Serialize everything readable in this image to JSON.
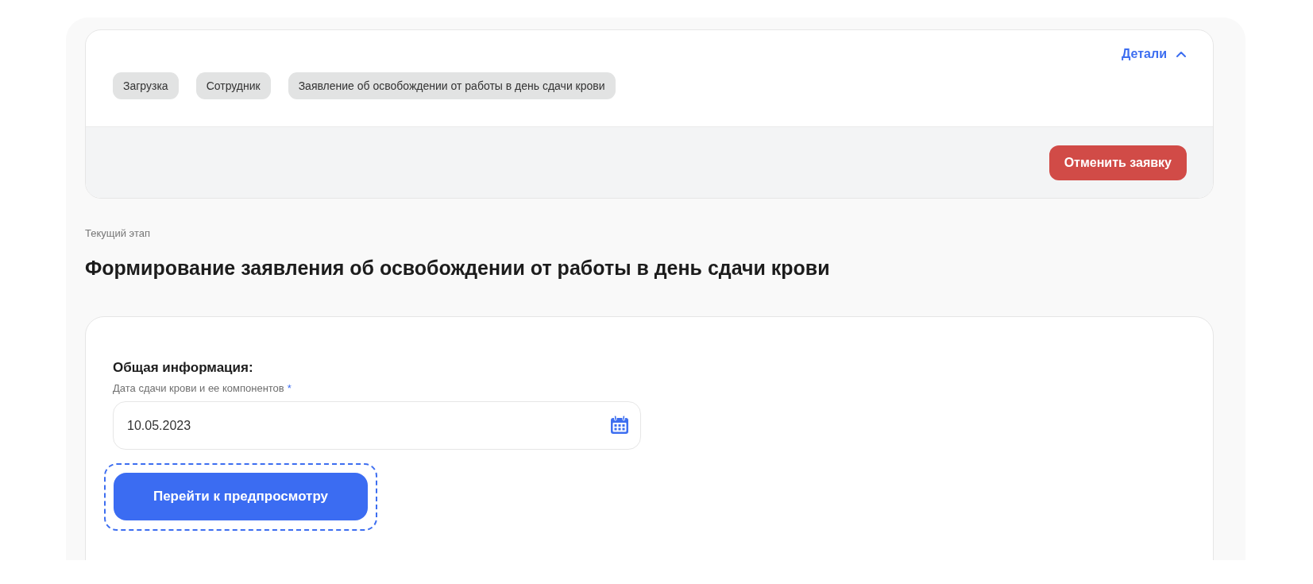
{
  "request_card": {
    "details_toggle": {
      "label": "Детали",
      "expanded": true
    },
    "tags": [
      "Загрузка",
      "Сотрудник",
      "Заявление об освобождении от работы в день сдачи крови"
    ],
    "cancel_button": "Отменить заявку"
  },
  "stage": {
    "caption": "Текущий этап",
    "title": "Формирование заявления об освобождении от работы в день сдачи крови"
  },
  "form": {
    "section_title": "Общая информация:",
    "date_field": {
      "label": "Дата сдачи крови и ее компонентов",
      "required_mark": "*",
      "value": "10.05.2023"
    },
    "preview_button": {
      "label": "Перейти к предпросмотру",
      "focused": true
    }
  }
}
